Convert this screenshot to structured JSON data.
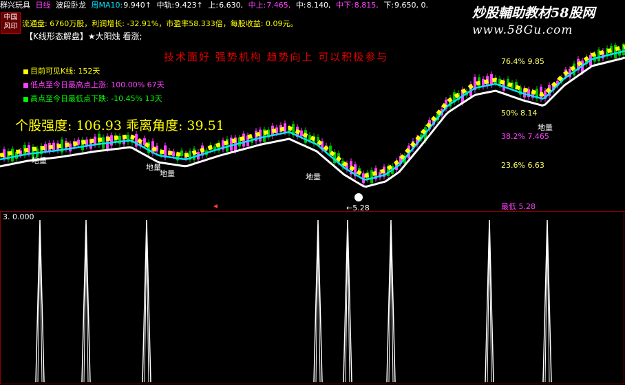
{
  "topbar": {
    "app": "群兴玩具",
    "period": "日线",
    "indicator": "波段卧龙",
    "ma_label": "周MA10:",
    "ma_value": "9.940↑",
    "mid_label": "中轨:",
    "mid_value": "9.423↑",
    "up_label": "上:",
    "up_value": "6.630,",
    "midup_label": "中上:",
    "midup_value": "7.465,",
    "center_label": "中:",
    "center_value": "8.140,",
    "middown_label": "中下:",
    "middown_value": "8.815,",
    "down_label": "下:",
    "down_value": "9.650, 0."
  },
  "badge": {
    "line1": "中国",
    "line2": "风印"
  },
  "info": {
    "line1": "流通盘: 6760万股，利润增长: -32.91%，市盈率58.333倍，每股收益: 0.09元。",
    "line2": "【K线形态解盘】★大阳烛 看涨;",
    "red": "技术面好  强势机构  趋势向上  可以积极参与"
  },
  "legend": [
    {
      "text": "目前可见K线: 152天",
      "color": "#ffff00"
    },
    {
      "text": "低点至今日最高点上涨: 100.00% 67天",
      "color": "#ff40ff"
    },
    {
      "text": "高点至今日最低点下跌: -10.45% 13天",
      "color": "#00ff00"
    }
  ],
  "strength": "个股强度: 106.93  乖离角度: 39.51",
  "levels": [
    {
      "text": "76.4%  9.85",
      "color": "#ffff66"
    },
    {
      "text": "50%  8.14",
      "color": "#ffff66"
    },
    {
      "text": "38.2%  7.465",
      "color": "#ff40ff"
    },
    {
      "text": "23.6%  6.63",
      "color": "#ffff66"
    },
    {
      "text": "最低  5.28",
      "color": "#ff40ff"
    }
  ],
  "dili_label": "地量",
  "low_arrow": "←5.28",
  "lower": {
    "label": "3.  0.000"
  },
  "watermark": {
    "line1": "炒股輔助教材58股网",
    "line2": "www.58Gu.com"
  },
  "colors": {
    "up": "#ff40ff",
    "down": "#00c000",
    "yellow": "#ffff00",
    "cyan": "#00e5ff",
    "white": "#ffffff",
    "red": "#e00000"
  }
}
